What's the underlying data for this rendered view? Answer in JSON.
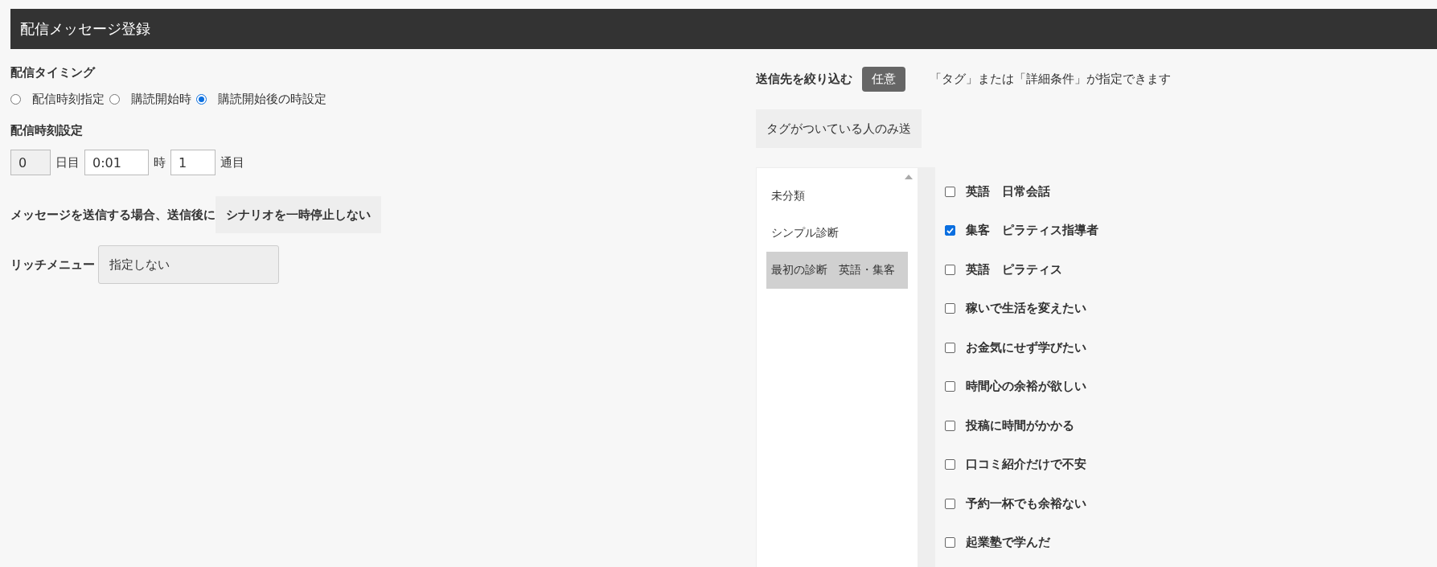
{
  "title": "配信メッセージ登録",
  "timing": {
    "label": "配信タイミング",
    "options": [
      {
        "label": "配信時刻指定",
        "selected": false
      },
      {
        "label": "購読開始時",
        "selected": false
      },
      {
        "label": "購読開始後の時設定",
        "selected": true
      }
    ]
  },
  "schedule": {
    "label": "配信時刻設定",
    "day": "0",
    "day_unit": "日目",
    "time": "0:01",
    "time_unit": "時",
    "count": "1",
    "count_unit": "通目"
  },
  "after_send": {
    "label": "メッセージを送信する場合、送信後に",
    "value": "シナリオを一時停止しない"
  },
  "rich_menu": {
    "label": "リッチメニュー",
    "value": "指定しない"
  },
  "filter": {
    "label": "送信先を絞り込む",
    "badge": "任意",
    "note": "「タグ」または「詳細条件」が指定できます",
    "mode": "タグがついている人のみ送"
  },
  "categories": [
    {
      "label": "未分類",
      "selected": false
    },
    {
      "label": "シンプル診断",
      "selected": false
    },
    {
      "label": "最初の診断　英語・集客",
      "selected": true
    }
  ],
  "tags": [
    {
      "label": "英語　日常会話",
      "checked": false
    },
    {
      "label": "集客　ピラティス指導者",
      "checked": true
    },
    {
      "label": "英語　ピラティス",
      "checked": false
    },
    {
      "label": "稼いで生活を変えたい",
      "checked": false
    },
    {
      "label": "お金気にせず学びたい",
      "checked": false
    },
    {
      "label": "時間心の余裕が欲しい",
      "checked": false
    },
    {
      "label": "投稿に時間がかかる",
      "checked": false
    },
    {
      "label": "口コミ紹介だけで不安",
      "checked": false
    },
    {
      "label": "予約一杯でも余裕ない",
      "checked": false
    },
    {
      "label": "起業塾で学んだ",
      "checked": false
    }
  ]
}
